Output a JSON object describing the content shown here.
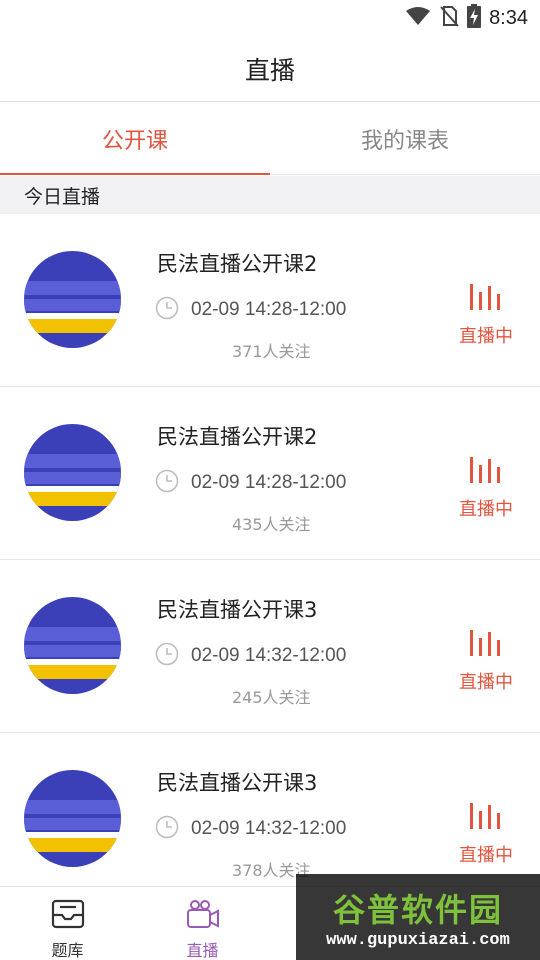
{
  "status_bar": {
    "time": "8:34",
    "icons": [
      "wifi-icon",
      "no-sim-icon",
      "battery-charging-icon"
    ]
  },
  "header": {
    "title": "直播"
  },
  "tabs": [
    {
      "label": "公开课",
      "active": true
    },
    {
      "label": "我的课表",
      "active": false
    }
  ],
  "section": {
    "title": "今日直播"
  },
  "courses": [
    {
      "title": "民法直播公开课2",
      "time": "02-09 14:28-12:00",
      "followers": "371人关注",
      "status": "直播中"
    },
    {
      "title": "民法直播公开课2",
      "time": "02-09 14:28-12:00",
      "followers": "435人关注",
      "status": "直播中"
    },
    {
      "title": "民法直播公开课3",
      "time": "02-09 14:32-12:00",
      "followers": "245人关注",
      "status": "直播中"
    },
    {
      "title": "民法直播公开课3",
      "time": "02-09 14:32-12:00",
      "followers": "378人关注",
      "status": "直播中"
    }
  ],
  "nav": [
    {
      "label": "题库",
      "icon": "inbox-icon",
      "active": false
    },
    {
      "label": "直播",
      "icon": "video-camera-icon",
      "active": true
    }
  ],
  "watermark": {
    "title": "谷普软件园",
    "url": "www.gupuxiazai.com"
  },
  "colors": {
    "accent": "#e2553f",
    "nav_active": "#9b59b6",
    "thumb_blue": "#3b3fb8",
    "thumb_yellow": "#f2c200"
  }
}
